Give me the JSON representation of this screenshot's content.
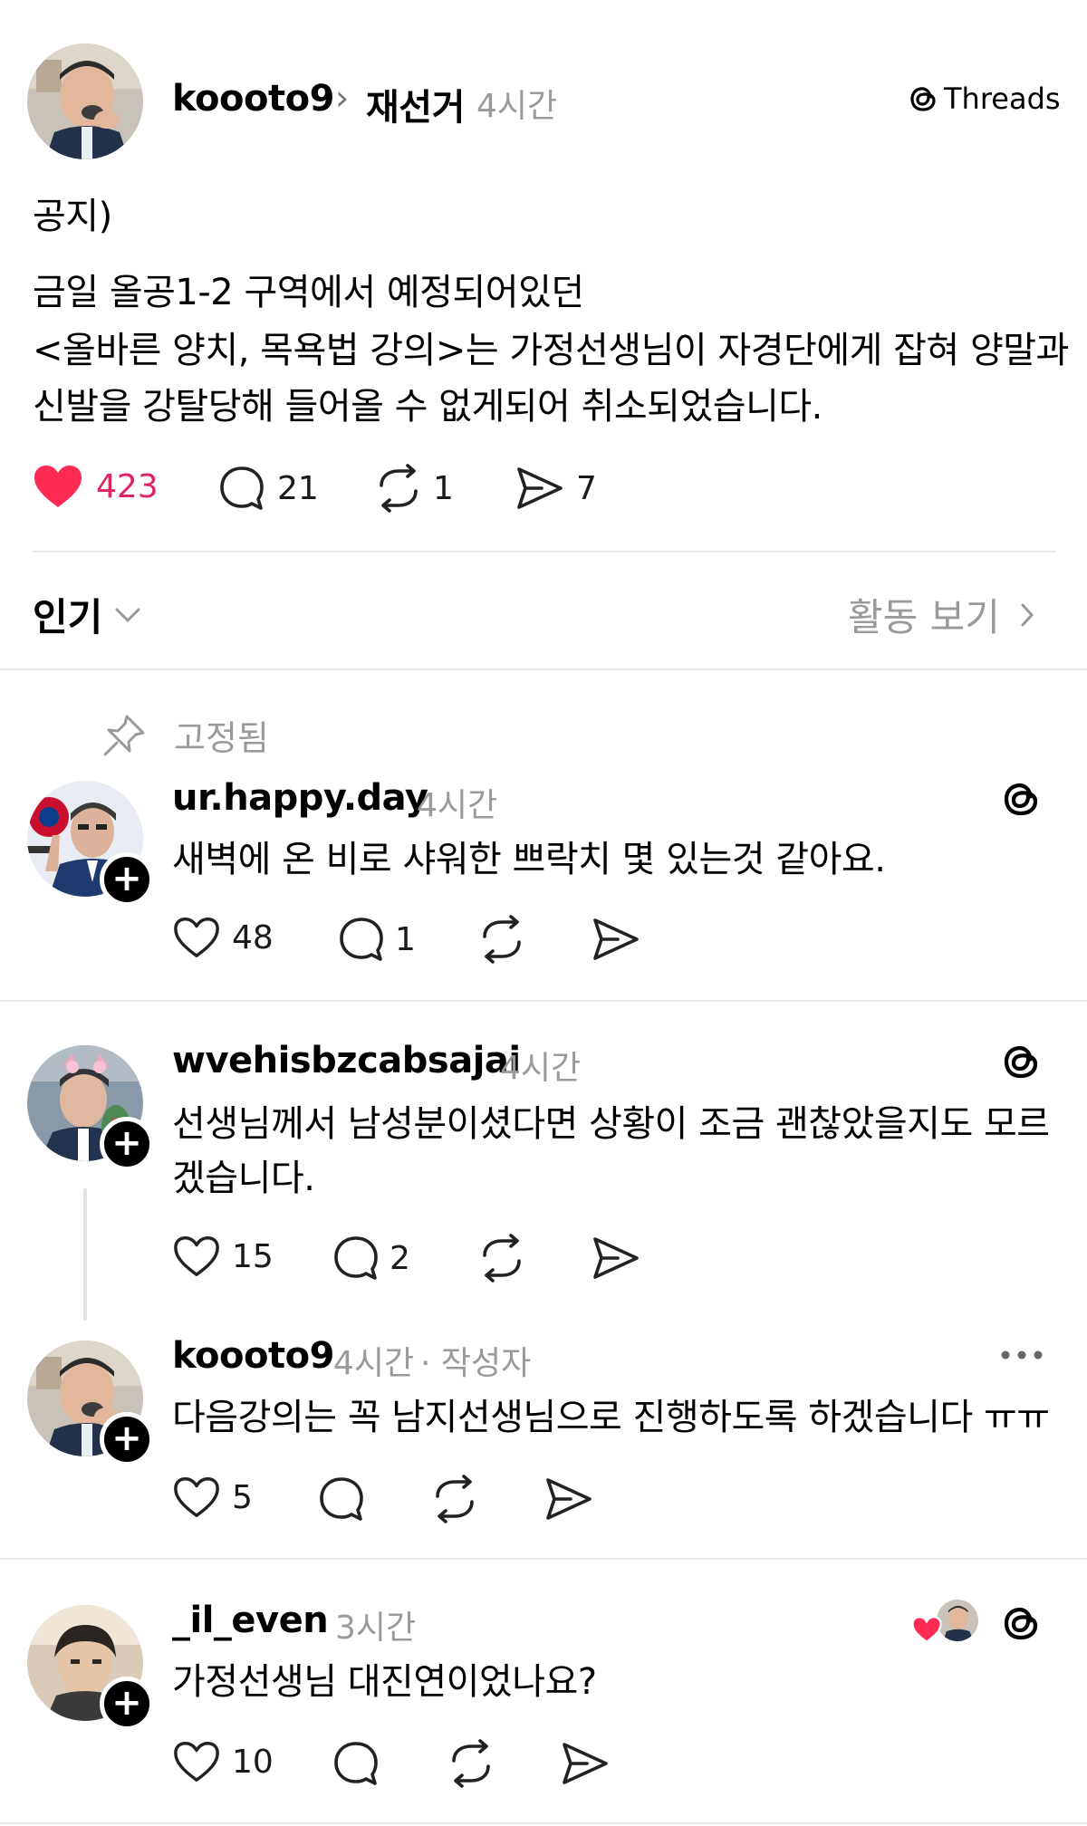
{
  "post": {
    "username": "koooto9",
    "separator": "›",
    "community": "재선거",
    "time": "4시간",
    "brand": "Threads",
    "body_line1": "공지)",
    "body_line2": "금일 올공1-2 구역에서 예정되어있던",
    "body_line3": "<올바른 양치, 목욕법 강의>는 가정선생님이 자경단에게 잡혀 양말과",
    "body_line4": "신발을 강탈당해 들어올 수 없게되어 취소되었습니다.",
    "likes": "423",
    "replies": "21",
    "reposts": "1",
    "shares": "7"
  },
  "sort_bar": {
    "sort_label": "인기",
    "activity_label": "활동 보기"
  },
  "pinned_label": "고정됨",
  "comments": [
    {
      "username": "ur.happy.day",
      "time": "4시간",
      "text": "새벽에 온 비로 샤워한 쁘락치 몇 있는것 같아요.",
      "likes": "48",
      "replies": "1"
    },
    {
      "username": "wvehisbzcabsajai",
      "time": "4시간",
      "text_line1": "선생님께서 남성분이셨다면 상황이 조금 괜찮았을지도 모르",
      "text_line2": "겠습니다.",
      "likes": "15",
      "replies": "2"
    },
    {
      "username": "koooto9",
      "time": "4시간",
      "author_tag": "· 작성자",
      "text": "다음강의는 꼭 남지선생님으로 진행하도록 하겠습니다 ㅠㅠ",
      "likes": "5"
    },
    {
      "username": "_il_even",
      "time": "3시간",
      "text": "가정선생님 대진연이었나요?",
      "likes": "10"
    }
  ],
  "colors": {
    "like_red": "#ff2b55",
    "like_count_red": "#e0245e",
    "meta_gray": "#9a9a9a",
    "divider": "#e6e6e6"
  },
  "icons": [
    "heart-icon",
    "reply-icon",
    "repost-icon",
    "share-icon",
    "threads-logo-icon",
    "pin-icon",
    "chevron-down-icon",
    "chevron-right-icon",
    "more-icon",
    "follow-plus-icon"
  ]
}
